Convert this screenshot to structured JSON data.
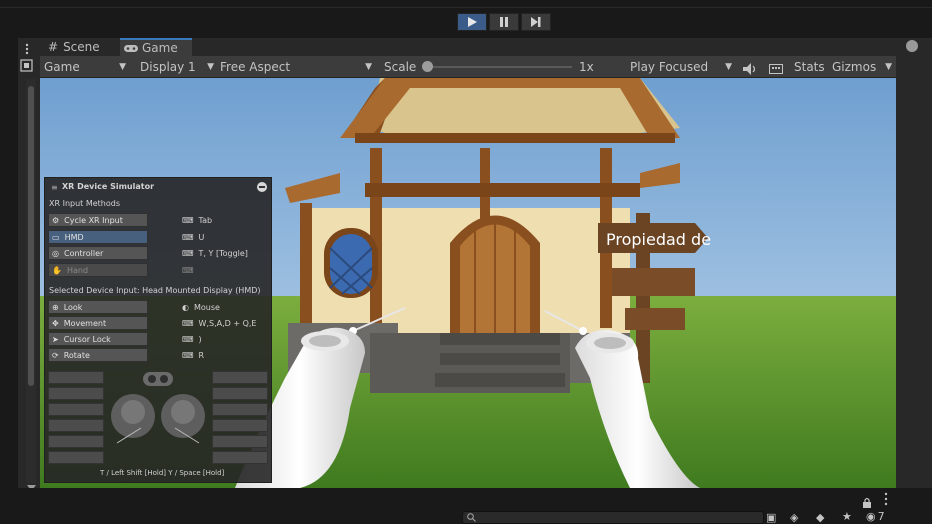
{
  "toolbar": {
    "play_icon": "play-icon",
    "pause_icon": "pause-icon",
    "step_icon": "step-icon",
    "accent": "#3b5b88"
  },
  "tabs": [
    {
      "label": "Scene",
      "icon": "grid-icon"
    },
    {
      "label": "Game",
      "icon": "gamepad-icon"
    }
  ],
  "game_toolbar": {
    "view": "Game",
    "display": "Display 1",
    "aspect": "Free Aspect",
    "scale_label": "Scale",
    "scale_value": "1x",
    "scale_fraction": 0.0,
    "play_mode": "Play Focused",
    "stats": "Stats",
    "gizmos": "Gizmos"
  },
  "scene": {
    "sign_text": "Propiedad de"
  },
  "simulator": {
    "title": "XR Device Simulator",
    "section_input": "XR Input Methods",
    "methods": [
      {
        "label": "Cycle XR Input",
        "key": "Tab",
        "state": "normal"
      },
      {
        "label": "HMD",
        "key": "U",
        "state": "selected"
      },
      {
        "label": "Controller",
        "key": "T, Y [Toggle]",
        "state": "normal"
      },
      {
        "label": "Hand",
        "key": "",
        "state": "disabled"
      }
    ],
    "section_selected": "Selected Device Input: Head Mounted Display (HMD)",
    "controls": [
      {
        "label": "Look",
        "key": "Mouse"
      },
      {
        "label": "Movement",
        "key": "W,S,A,D + Q,E"
      },
      {
        "label": "Cursor Lock",
        "key": ")"
      },
      {
        "label": "Rotate",
        "key": "R"
      }
    ],
    "footer": "T / Left Shift [Hold]  Y / Space [Hold]"
  },
  "status": {
    "count": "7"
  }
}
